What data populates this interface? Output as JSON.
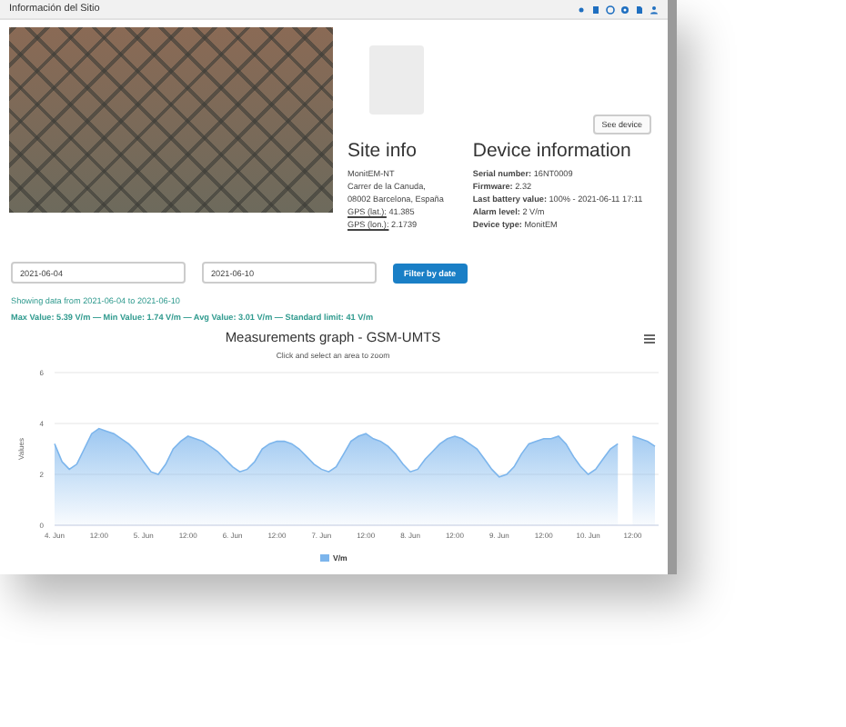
{
  "header": {
    "title": "Información del Sitio"
  },
  "site_info": {
    "heading": "Site info",
    "lines": [
      {
        "kind": "plain",
        "text": "MonitEM-NT"
      },
      {
        "kind": "plain",
        "text": "Carrer de la Canuda,"
      },
      {
        "kind": "plain",
        "text": "08002 Barcelona, España"
      },
      {
        "kind": "link",
        "label": "GPS (lat.):",
        "value": "41.385"
      },
      {
        "kind": "link",
        "label": "GPS (lon.):",
        "value": "2.1739"
      }
    ]
  },
  "device_info": {
    "heading": "Device information",
    "button": "See device",
    "fields": [
      {
        "label": "Serial number:",
        "value": "16NT0009"
      },
      {
        "label": "Firmware:",
        "value": "2.32"
      },
      {
        "label": "Last battery value:",
        "value": "100% - 2021-06-11 17:11"
      },
      {
        "label": "Alarm level:",
        "value": "2 V/m"
      },
      {
        "label": "Device type:",
        "value": "MonitEM"
      }
    ]
  },
  "filter": {
    "start_date": "2021-06-04",
    "end_date": "2021-06-10",
    "button": "Filter by date"
  },
  "summary": {
    "range_text": "Showing data from 2021-06-04 to 2021-06-10",
    "stats_text": "Max Value: 5.39 V/m — Min Value: 1.74 V/m — Avg Value: 3.01 V/m — Standard limit: 41 V/m"
  },
  "chart": {
    "subtitle": "Click and select an area to zoom",
    "chart_data": {
      "type": "area",
      "title": "Measurements graph - GSM-UMTS",
      "ylabel": "Values",
      "categories": [
        "4. Jun",
        null,
        null,
        null,
        null,
        null,
        "12:00",
        null,
        null,
        null,
        null,
        null,
        "5. Jun",
        null,
        null,
        null,
        null,
        null,
        "12:00",
        null,
        null,
        null,
        null,
        null,
        "6. Jun",
        null,
        null,
        null,
        null,
        null,
        "12:00",
        null,
        null,
        null,
        null,
        null,
        "7. Jun",
        null,
        null,
        null,
        null,
        null,
        "12:00",
        null,
        null,
        null,
        null,
        null,
        "8. Jun",
        null,
        null,
        null,
        null,
        null,
        "12:00",
        null,
        null,
        null,
        null,
        null,
        "9. Jun",
        null,
        null,
        null,
        null,
        null,
        "12:00",
        null,
        null,
        null,
        null,
        null,
        "10. Jun",
        null,
        null,
        null,
        null,
        null,
        "12:00",
        null,
        null,
        null
      ],
      "series": [
        {
          "name": "V/m",
          "color": "#7cb5ec",
          "values": [
            3.2,
            2.5,
            2.2,
            2.4,
            3.0,
            3.6,
            3.8,
            3.7,
            3.6,
            3.4,
            3.2,
            2.9,
            2.5,
            2.1,
            2.0,
            2.4,
            3.0,
            3.3,
            3.5,
            3.4,
            3.3,
            3.1,
            2.9,
            2.6,
            2.3,
            2.1,
            2.2,
            2.5,
            3.0,
            3.2,
            3.3,
            3.3,
            3.2,
            3.0,
            2.7,
            2.4,
            2.2,
            2.1,
            2.3,
            2.8,
            3.3,
            3.5,
            3.6,
            3.4,
            3.3,
            3.1,
            2.8,
            2.4,
            2.1,
            2.2,
            2.6,
            2.9,
            3.2,
            3.4,
            3.5,
            3.4,
            3.2,
            3.0,
            2.6,
            2.2,
            1.9,
            2.0,
            2.3,
            2.8,
            3.2,
            3.3,
            3.4,
            3.4,
            3.5,
            3.2,
            2.7,
            2.3,
            2.0,
            2.2,
            2.6,
            3.0,
            3.2,
            null,
            3.5,
            3.4,
            3.3,
            3.1
          ]
        }
      ],
      "ylim": [
        0,
        6
      ],
      "yticks": [
        0,
        2,
        4,
        6
      ]
    }
  }
}
